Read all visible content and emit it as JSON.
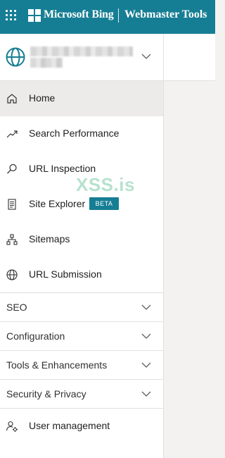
{
  "header": {
    "brand": "Microsoft Bing",
    "product": "Webmaster Tools",
    "bar_color": "#167e94",
    "icons": {
      "apps": "app-launcher-icon",
      "logo": "microsoft-logo-icon"
    }
  },
  "site_switcher": {
    "icon": "globe-icon",
    "site_name_hidden": true
  },
  "nav": {
    "items": [
      {
        "label": "Home",
        "icon": "home-icon",
        "active": true
      },
      {
        "label": "Search Performance",
        "icon": "trend-up-icon"
      },
      {
        "label": "URL Inspection",
        "icon": "search-icon"
      },
      {
        "label": "Site Explorer",
        "icon": "site-explorer-icon",
        "badge": "BETA"
      },
      {
        "label": "Sitemaps",
        "icon": "sitemap-icon"
      },
      {
        "label": "URL Submission",
        "icon": "globe-icon"
      }
    ],
    "sections": [
      {
        "label": "SEO"
      },
      {
        "label": "Configuration"
      },
      {
        "label": "Tools & Enhancements"
      },
      {
        "label": "Security & Privacy"
      }
    ],
    "bottom_item": {
      "label": "User management",
      "icon": "user-settings-icon"
    }
  },
  "watermark": "XSS.is",
  "colors": {
    "accent": "#167e94",
    "active_bg": "#edebe9",
    "watermark": "#9fd9bd"
  }
}
